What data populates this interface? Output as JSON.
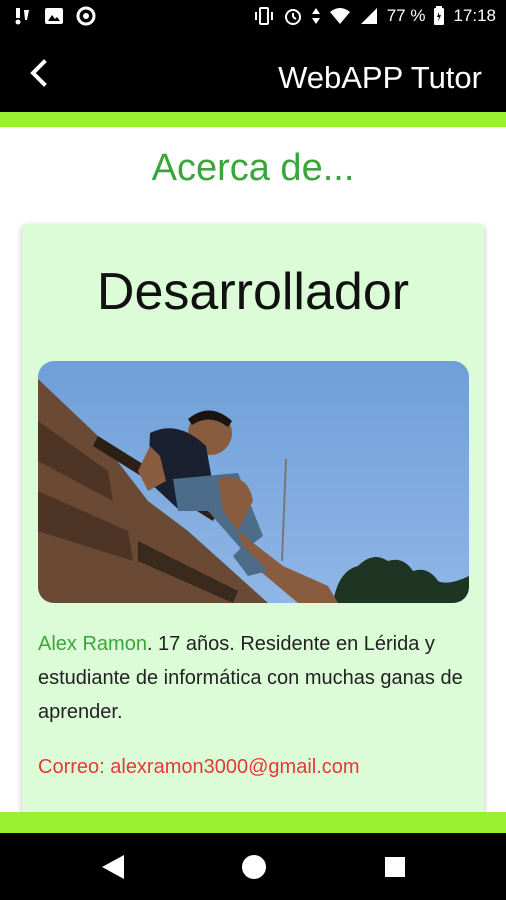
{
  "status_bar": {
    "battery": "77 %",
    "time": "17:18"
  },
  "app_bar": {
    "title": "WebAPP Tutor"
  },
  "page": {
    "title": "Acerca de..."
  },
  "developer_card": {
    "heading": "Desarrollador",
    "name": "Alex Ramon",
    "bio": ". 17 años. Residente en Lérida y estudiante de informática con muchas ganas de aprender.",
    "email_text": "Correo: alexramon3000@gmail.com"
  },
  "colors": {
    "accent_green": "#99f030",
    "title_green": "#3aa63a",
    "card_bg": "#dcfcd8",
    "email_red": "#e53935"
  }
}
